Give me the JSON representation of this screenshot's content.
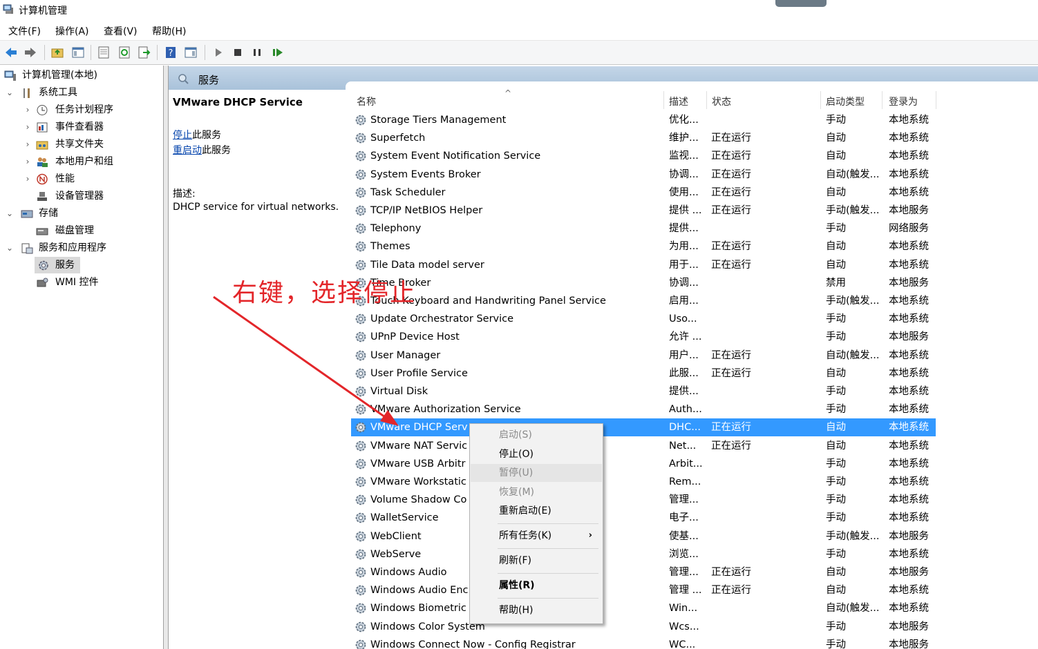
{
  "window": {
    "title": "计算机管理"
  },
  "menu": [
    "文件(F)",
    "操作(A)",
    "查看(V)",
    "帮助(H)"
  ],
  "tree": {
    "root": "计算机管理(本地)",
    "system_tools": "系统工具",
    "task_scheduler": "任务计划程序",
    "event_viewer": "事件查看器",
    "shared_folders": "共享文件夹",
    "local_users": "本地用户和组",
    "performance": "性能",
    "device_manager": "设备管理器",
    "storage": "存储",
    "disk_management": "磁盘管理",
    "services_apps": "服务和应用程序",
    "services": "服务",
    "wmi": "WMI 控件"
  },
  "header": {
    "title": "服务"
  },
  "detail": {
    "service_name": "VMware DHCP Service",
    "stop_link": "停止",
    "stop_suffix": "此服务",
    "restart_link": "重启动",
    "restart_suffix": "此服务",
    "desc_label": "描述:",
    "description": "DHCP service for virtual networks."
  },
  "columns": {
    "name": "名称",
    "desc": "描述",
    "state": "状态",
    "startup": "启动类型",
    "logon": "登录为"
  },
  "rows": [
    {
      "name": "Storage Tiers Management",
      "desc": "优化...",
      "state": "",
      "startup": "手动",
      "logon": "本地系统"
    },
    {
      "name": "Superfetch",
      "desc": "维护...",
      "state": "正在运行",
      "startup": "自动",
      "logon": "本地系统"
    },
    {
      "name": "System Event Notification Service",
      "desc": "监视...",
      "state": "正在运行",
      "startup": "自动",
      "logon": "本地系统"
    },
    {
      "name": "System Events Broker",
      "desc": "协调...",
      "state": "正在运行",
      "startup": "自动(触发...",
      "logon": "本地系统"
    },
    {
      "name": "Task Scheduler",
      "desc": "使用...",
      "state": "正在运行",
      "startup": "自动",
      "logon": "本地系统"
    },
    {
      "name": "TCP/IP NetBIOS Helper",
      "desc": "提供 ...",
      "state": "正在运行",
      "startup": "手动(触发...",
      "logon": "本地服务"
    },
    {
      "name": "Telephony",
      "desc": "提供...",
      "state": "",
      "startup": "手动",
      "logon": "网络服务"
    },
    {
      "name": "Themes",
      "desc": "为用...",
      "state": "正在运行",
      "startup": "自动",
      "logon": "本地系统"
    },
    {
      "name": "Tile Data model server",
      "desc": "用于...",
      "state": "正在运行",
      "startup": "自动",
      "logon": "本地系统"
    },
    {
      "name": "Time Broker",
      "desc": "协调...",
      "state": "",
      "startup": "禁用",
      "logon": "本地服务"
    },
    {
      "name": "Touch Keyboard and Handwriting Panel Service",
      "desc": "启用...",
      "state": "",
      "startup": "手动(触发...",
      "logon": "本地系统"
    },
    {
      "name": "Update Orchestrator Service",
      "desc": "Uso...",
      "state": "",
      "startup": "手动",
      "logon": "本地系统"
    },
    {
      "name": "UPnP Device Host",
      "desc": "允许 ...",
      "state": "",
      "startup": "手动",
      "logon": "本地服务"
    },
    {
      "name": "User Manager",
      "desc": "用户...",
      "state": "正在运行",
      "startup": "自动(触发...",
      "logon": "本地系统"
    },
    {
      "name": "User Profile Service",
      "desc": "此服...",
      "state": "正在运行",
      "startup": "自动",
      "logon": "本地系统"
    },
    {
      "name": "Virtual Disk",
      "desc": "提供...",
      "state": "",
      "startup": "手动",
      "logon": "本地系统"
    },
    {
      "name": "VMware Authorization Service",
      "desc": "Auth...",
      "state": "",
      "startup": "手动",
      "logon": "本地系统"
    },
    {
      "name": "VMware DHCP Serv",
      "desc": "DHC...",
      "state": "正在运行",
      "startup": "自动",
      "logon": "本地系统"
    },
    {
      "name": "VMware NAT Servic",
      "desc": "Net...",
      "state": "正在运行",
      "startup": "自动",
      "logon": "本地系统"
    },
    {
      "name": "VMware USB Arbitr",
      "desc": "Arbit...",
      "state": "",
      "startup": "手动",
      "logon": "本地系统"
    },
    {
      "name": "VMware Workstatic",
      "desc": "Rem...",
      "state": "",
      "startup": "手动",
      "logon": "本地系统"
    },
    {
      "name": "Volume Shadow Co",
      "desc": "管理...",
      "state": "",
      "startup": "手动",
      "logon": "本地系统"
    },
    {
      "name": "WalletService",
      "desc": "电子...",
      "state": "",
      "startup": "手动",
      "logon": "本地系统"
    },
    {
      "name": "WebClient",
      "desc": "使基...",
      "state": "",
      "startup": "手动(触发...",
      "logon": "本地服务"
    },
    {
      "name": "WebServe",
      "desc": "浏览...",
      "state": "",
      "startup": "手动",
      "logon": "本地系统"
    },
    {
      "name": "Windows Audio",
      "desc": "管理...",
      "state": "正在运行",
      "startup": "自动",
      "logon": "本地服务"
    },
    {
      "name": "Windows Audio Enc",
      "desc": "管理 ...",
      "state": "正在运行",
      "startup": "自动",
      "logon": "本地系统"
    },
    {
      "name": "Windows Biometric",
      "desc": "Win...",
      "state": "",
      "startup": "自动(触发...",
      "logon": "本地系统"
    },
    {
      "name": "Windows Color System",
      "desc": "Wcs...",
      "state": "",
      "startup": "手动",
      "logon": "本地服务"
    },
    {
      "name": "Windows Connect Now - Config Registrar",
      "desc": "WC...",
      "state": "",
      "startup": "手动",
      "logon": "本地服务"
    }
  ],
  "context_menu": {
    "start": "启动(S)",
    "stop": "停止(O)",
    "pause": "暂停(U)",
    "resume": "恢复(M)",
    "restart": "重新启动(E)",
    "all_tasks": "所有任务(K)",
    "refresh": "刷新(F)",
    "properties": "属性(R)",
    "help": "帮助(H)"
  },
  "annotation": {
    "text": "右键，选择停止"
  },
  "colors": {
    "selection": "#3399ff",
    "annotation": "#e3262a",
    "header": "#b7cde2"
  }
}
